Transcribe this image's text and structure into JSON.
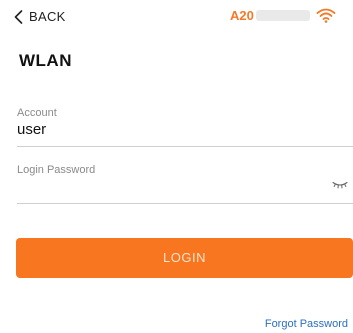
{
  "header": {
    "back_label": "BACK",
    "network_name": "A20",
    "network_name_masked": true
  },
  "page": {
    "title": "WLAN"
  },
  "form": {
    "account_label": "Account",
    "account_value": "user",
    "password_label": "Login Password",
    "password_value": ""
  },
  "actions": {
    "login_label": "LOGIN",
    "forgot_password_label": "Forgot Password"
  },
  "icons": {
    "back": "chevron-left-icon",
    "wifi": "wifi-icon",
    "password_visibility": "eye-closed-icon"
  },
  "colors": {
    "accent": "#f7761f",
    "network_name": "#f47a2a",
    "link": "#2b6fbf",
    "label": "#8a8a8a"
  }
}
